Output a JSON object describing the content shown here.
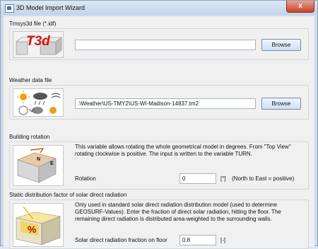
{
  "window": {
    "title": "3D Model Import Wizard",
    "close_glyph": "x"
  },
  "trnsys3d": {
    "label": "Trnsys3d file (*.idf)",
    "value": "",
    "browse": "Browse",
    "logo_text": "T3d"
  },
  "weather": {
    "label": "Weather data file",
    "value": ".\\Weather\\US-TMY2\\US-WI-Madison-14837.tm2",
    "browse": "Browse"
  },
  "rotation": {
    "label": "Building rotation",
    "description": "This variable allows rotating the whole geometrical model in degrees. From \"Top View\" rotating clockwise is positive. The input is written to the variable TURN.",
    "field_label": "Rotation",
    "value": "0",
    "unit": "[°]",
    "hint": "(North to East = positive)",
    "compass_n": "N",
    "compass_e": "E"
  },
  "solar": {
    "label": "Static distribution factor of solar direct radiation",
    "description": "Only used in standard solar direct radiation distribution model (used to determine GEOSURF-Values). Enter the fraction of direct solar radiation, hitting the floor. The remaining direct radiation is distributed area-weighted to the surrounding walls.",
    "field_label": "Solar direct radiation fraction on floor",
    "value": "0.8",
    "unit": "[-]",
    "pic_text": "%"
  }
}
